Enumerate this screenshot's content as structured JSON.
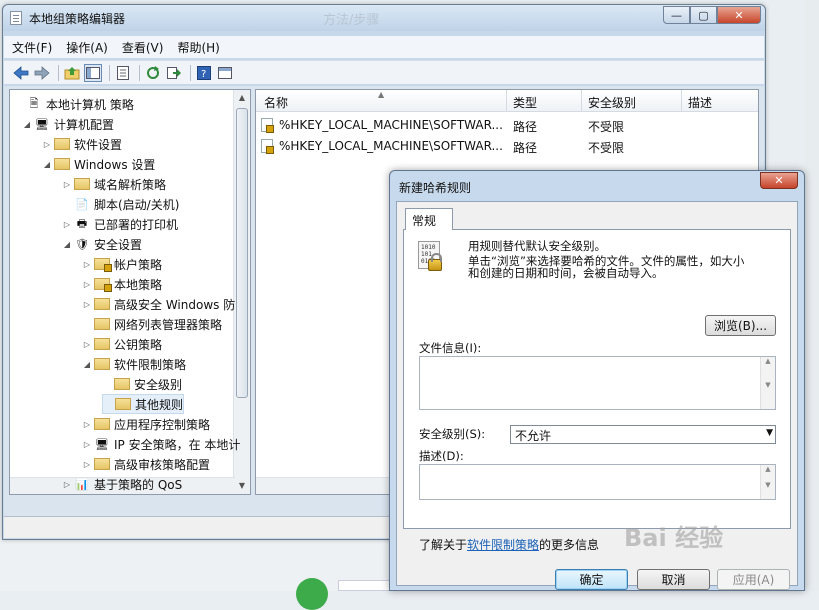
{
  "main_window": {
    "title": "本地组策略编辑器",
    "controls": {
      "minimize": "—",
      "maximize": "▢",
      "close": "✕"
    },
    "menus": [
      "文件(F)",
      "操作(A)",
      "查看(V)",
      "帮助(H)"
    ],
    "toolbar_icons": [
      "back-icon",
      "forward-icon",
      "up-folder-icon",
      "show-tree-icon",
      "properties-icon",
      "refresh-icon",
      "export-icon",
      "help-icon",
      "view-icon"
    ]
  },
  "tree": [
    {
      "label": "本地计算机 策略",
      "expander": "",
      "icon": "policy"
    },
    {
      "label": "计算机配置",
      "expander": "◢",
      "icon": "computer"
    },
    {
      "label": "软件设置",
      "expander": "▷",
      "icon": "folder"
    },
    {
      "label": "Windows 设置",
      "expander": "◢",
      "icon": "folder"
    },
    {
      "label": "域名解析策略",
      "expander": "▷",
      "icon": "folder"
    },
    {
      "label": "脚本(启动/关机)",
      "expander": "",
      "icon": "script"
    },
    {
      "label": "已部署的打印机",
      "expander": "▷",
      "icon": "printer"
    },
    {
      "label": "安全设置",
      "expander": "◢",
      "icon": "security"
    },
    {
      "label": "帐户策略",
      "expander": "▷",
      "icon": "folder-lock"
    },
    {
      "label": "本地策略",
      "expander": "▷",
      "icon": "folder-lock"
    },
    {
      "label": "高级安全 Windows 防",
      "expander": "▷",
      "icon": "folder"
    },
    {
      "label": "网络列表管理器策略",
      "expander": "",
      "icon": "folder"
    },
    {
      "label": "公钥策略",
      "expander": "▷",
      "icon": "folder"
    },
    {
      "label": "软件限制策略",
      "expander": "◢",
      "icon": "folder"
    },
    {
      "label": "安全级别",
      "expander": "",
      "icon": "folder"
    },
    {
      "label": "其他规则",
      "expander": "",
      "icon": "folder"
    },
    {
      "label": "应用程序控制策略",
      "expander": "▷",
      "icon": "folder"
    },
    {
      "label": "IP 安全策略，在 本地计",
      "expander": "▷",
      "icon": "ipsec"
    },
    {
      "label": "高级审核策略配置",
      "expander": "▷",
      "icon": "folder"
    },
    {
      "label": "基于策略的 QoS",
      "expander": "▷",
      "icon": "qos"
    }
  ],
  "list": {
    "columns": [
      "名称",
      "类型",
      "安全级别",
      "描述"
    ],
    "rows": [
      {
        "name": "%HKEY_LOCAL_MACHINE\\SOFTWAR...",
        "type": "路径",
        "level": "不受限"
      },
      {
        "name": "%HKEY_LOCAL_MACHINE\\SOFTWAR...",
        "type": "路径",
        "level": "不受限"
      }
    ]
  },
  "dialog": {
    "title": "新建哈希规则",
    "close": "✕",
    "tab": "常规",
    "line1": "用规则替代默认安全级别。",
    "line2": "单击“浏览”来选择要哈希的文件。文件的属性，如大小",
    "line3": "和创建的日期和时间，会被自动导入。",
    "browse_button": "浏览(B)...",
    "file_info_label": "文件信息(I):",
    "security_level_label": "安全级别(S):",
    "security_level_value": "不允许",
    "description_label": "描述(D):",
    "learn_prefix": "了解关于",
    "learn_link": "软件限制策略",
    "learn_suffix": "的更多信息",
    "ok": "确定",
    "cancel": "取消",
    "apply": "应用(A)"
  },
  "background": {
    "top_text": "方法/步骤"
  },
  "watermark": "Bai 经验"
}
